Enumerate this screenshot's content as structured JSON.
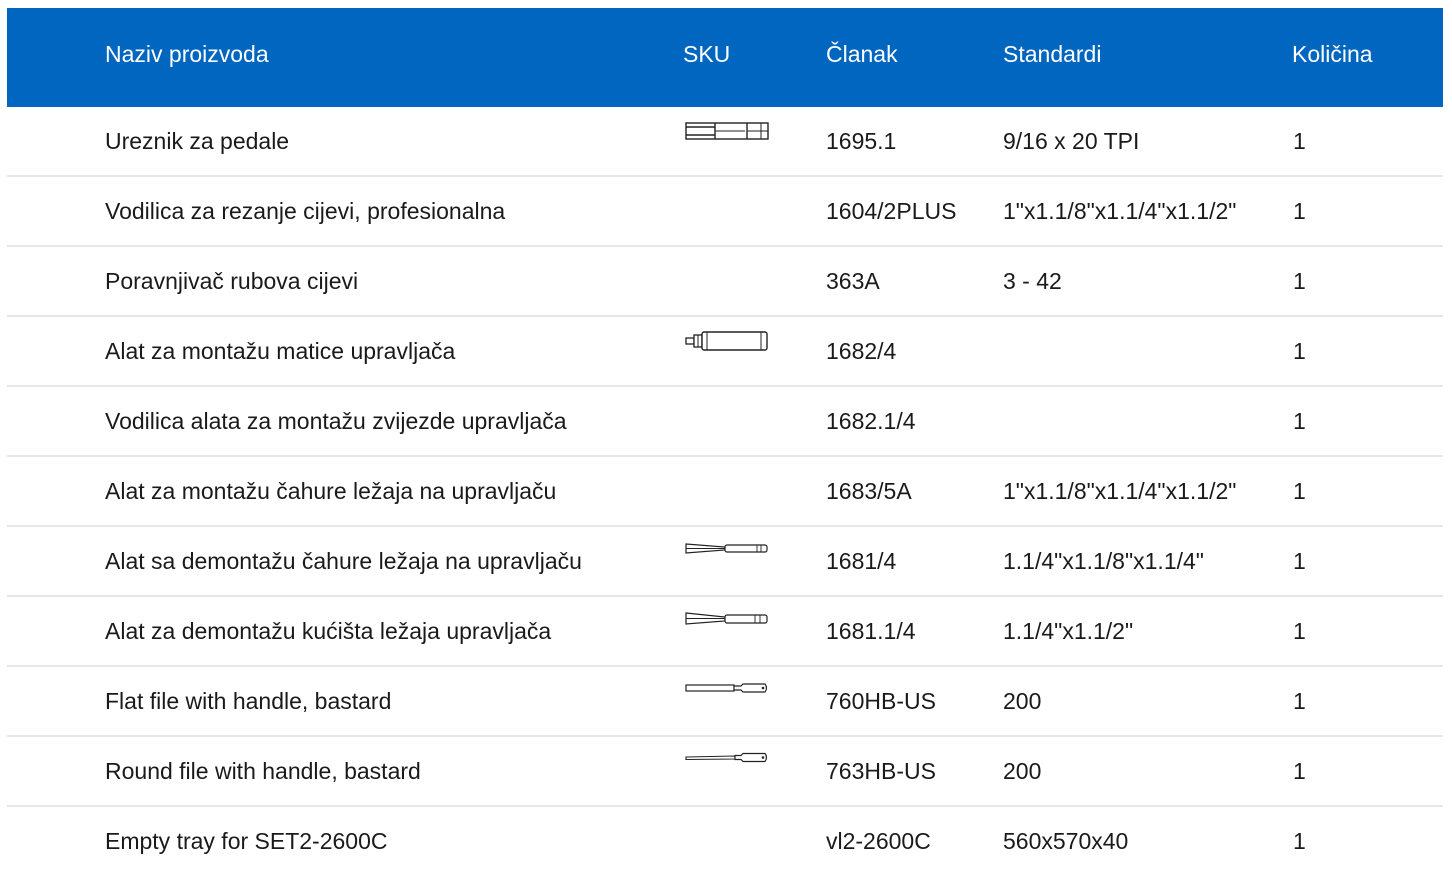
{
  "header": {
    "name": "Naziv proizvoda",
    "sku": "SKU",
    "article": "Članak",
    "standards": "Standardi",
    "quantity": "Količina"
  },
  "rows": [
    {
      "name": "Ureznik za pedale",
      "thumb": "pedal-tap-icon",
      "article": "1695.1",
      "standards": "9/16 x 20 TPI",
      "quantity": "1"
    },
    {
      "name": "Vodilica za rezanje cijevi, profesionalna",
      "thumb": "",
      "article": "1604/2PLUS",
      "standards": "1\"x1.1/8\"x1.1/4\"x1.1/2\"",
      "quantity": "1"
    },
    {
      "name": "Poravnjivač rubova cijevi",
      "thumb": "",
      "article": "363A",
      "standards": "3 - 42",
      "quantity": "1"
    },
    {
      "name": "Alat za montažu matice upravljača",
      "thumb": "nut-setting-tool-icon",
      "article": "1682/4",
      "standards": "",
      "quantity": "1"
    },
    {
      "name": "Vodilica alata za montažu zvijezde upravljača",
      "thumb": "",
      "article": "1682.1/4",
      "standards": "",
      "quantity": "1"
    },
    {
      "name": "Alat za montažu čahure ležaja na upravljaču",
      "thumb": "",
      "article": "1683/5A",
      "standards": "1\"x1.1/8\"x1.1/4\"x1.1/2\"",
      "quantity": "1"
    },
    {
      "name": "Alat sa demontažu čahure ležaja na upravljaču",
      "thumb": "cup-remover-icon",
      "article": "1681/4",
      "standards": "1.1/4\"x1.1/8\"x1.1/4\"",
      "quantity": "1"
    },
    {
      "name": "Alat za demontažu kućišta ležaja upravljača",
      "thumb": "cup-remover-icon",
      "article": "1681.1/4",
      "standards": "1.1/4\"x1.1/2\"",
      "quantity": "1"
    },
    {
      "name": "Flat file with handle, bastard",
      "thumb": "flat-file-icon",
      "article": "760HB-US",
      "standards": "200",
      "quantity": "1"
    },
    {
      "name": "Round file with handle, bastard",
      "thumb": "round-file-icon",
      "article": "763HB-US",
      "standards": "200",
      "quantity": "1"
    },
    {
      "name": "Empty tray for SET2-2600C",
      "thumb": "",
      "article": "vl2-2600C",
      "standards": "560x570x40",
      "quantity": "1"
    }
  ]
}
